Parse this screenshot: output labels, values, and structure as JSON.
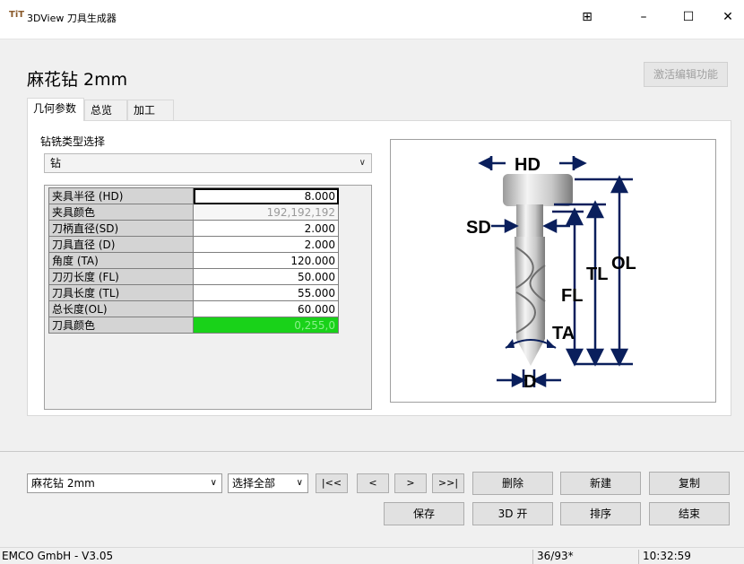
{
  "window": {
    "icon_text": "TiT",
    "title": "3DView 刀具生成器",
    "buttons": {
      "layout": "⊞",
      "minimize": "–",
      "maximize": "☐",
      "close": "✕"
    }
  },
  "header": {
    "title": "麻花钻 2mm",
    "activate_label": "激活编辑功能"
  },
  "tabs": [
    {
      "label": "几何参数",
      "active": true
    },
    {
      "label": "总览",
      "active": false
    },
    {
      "label": "加工",
      "active": false
    }
  ],
  "type_select": {
    "label": "钻铣类型选择",
    "value": "钻"
  },
  "params": [
    {
      "label": "夹具半径 (HD)",
      "value": "8.000"
    },
    {
      "label": "夹具颜色",
      "value": "192,192,192"
    },
    {
      "label": "刀柄直径(SD)",
      "value": "2.000"
    },
    {
      "label": "刀具直径 (D)",
      "value": "2.000"
    },
    {
      "label": "角度 (TA)",
      "value": "120.000"
    },
    {
      "label": "刀刃长度 (FL)",
      "value": "50.000"
    },
    {
      "label": "刀具长度 (TL)",
      "value": "55.000"
    },
    {
      "label": "总长度(OL)",
      "value": "60.000"
    },
    {
      "label": "刀具颜色",
      "value": "0,255,0"
    }
  ],
  "diagram": {
    "labels": {
      "hd": "HD",
      "sd": "SD",
      "ol": "OL",
      "tl": "TL",
      "fl": "FL",
      "ta": "TA",
      "d": "D"
    }
  },
  "bottom": {
    "tool_select": "麻花钻 2mm",
    "filter_select": "选择全部",
    "nav": {
      "first": "|<<",
      "prev": "<",
      "next": ">",
      "last": ">>|"
    },
    "actions": {
      "delete": "删除",
      "new": "新建",
      "copy": "复制",
      "save": "保存",
      "open3d": "3D 开",
      "sort": "排序",
      "end": "结束"
    }
  },
  "status": {
    "company": "EMCO GmbH  -  V3.05",
    "count": "36/93*",
    "time": "10:32:59"
  },
  "colors": {
    "accent_arrow": "#0a1f5c",
    "tool_color": "#19d219"
  }
}
